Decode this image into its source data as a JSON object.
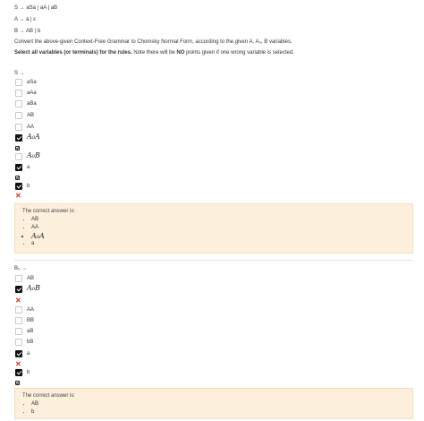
{
  "question": {
    "rules": [
      "S → aSa | aA | aB",
      "A → a | ε",
      "B → AB | b"
    ],
    "instruction": "Convert the above-given Context-Free Grammar to Chomsky Normal Form, according to the given A, A₀, B variables.",
    "select_all_bold": "Select all variables (or terminals) for the rules.",
    "select_all_rest": " Note there will be ",
    "no_word": "NO",
    "select_all_tail": "  points given if one wrong variable is selected."
  },
  "section1": {
    "heading": "S →",
    "options": [
      {
        "label": "aSa",
        "checked": false
      },
      {
        "label": "aAa",
        "checked": false
      },
      {
        "label": "aBa",
        "checked": false
      },
      {
        "label": "AB",
        "checked": false
      },
      {
        "label": "AA",
        "checked": false
      },
      {
        "label": "A₀A",
        "checked": true
      },
      {
        "label": "A₀B",
        "checked": false
      },
      {
        "label": "a",
        "checked": true
      },
      {
        "label": "b",
        "checked": true
      }
    ],
    "answer_title": "The correct answer is:",
    "answers": [
      "AB",
      "AA",
      "A₀A",
      "a"
    ]
  },
  "section2": {
    "heading": "B₀ →",
    "options": [
      {
        "label": "AB",
        "checked": false
      },
      {
        "label": "A₀B",
        "checked": true
      },
      {
        "label": "AA",
        "checked": false
      },
      {
        "label": "BB",
        "checked": false
      },
      {
        "label": "aB",
        "checked": false
      },
      {
        "label": "bB",
        "checked": false
      },
      {
        "label": "a",
        "checked": true
      },
      {
        "label": "b",
        "checked": true
      }
    ],
    "answer_title": "The correct answer is:",
    "answers": [
      "AB",
      "b"
    ]
  },
  "colors": {
    "correct_bg": "#fcefdc",
    "wrong_mark": "#d93025",
    "checked": "#111111"
  }
}
